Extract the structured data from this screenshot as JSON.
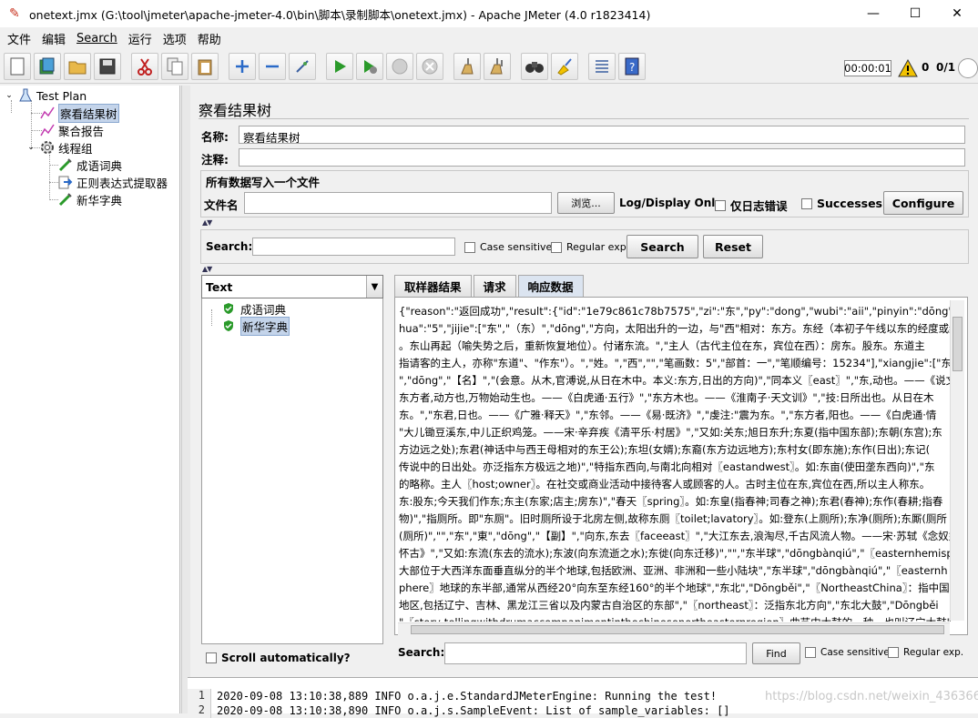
{
  "window": {
    "title": "onetext.jmx (G:\\tool\\jmeter\\apache-jmeter-4.0\\bin\\脚本\\录制脚本\\onetext.jmx) - Apache JMeter (4.0 r1823414)",
    "minimize": "—",
    "maximize": "☐",
    "close": "✕"
  },
  "menu": [
    "文件",
    "编辑",
    "Search",
    "运行",
    "选项",
    "帮助"
  ],
  "status": {
    "timer": "00:00:01",
    "errors": "0",
    "threads": "0/1"
  },
  "tree": {
    "test_plan": "Test Plan",
    "items": [
      "察看结果树",
      "聚合报告",
      "线程组",
      "成语词典",
      "正则表达式提取器",
      "新华字典"
    ]
  },
  "panel": {
    "title": "察看结果树",
    "name_label": "名称:",
    "name_value": "察看结果树",
    "comment_label": "注释:",
    "comment_value": "",
    "file_group_title": "所有数据写入一个文件",
    "filename_label": "文件名",
    "filename_value": "",
    "browse": "浏览...",
    "log_display": "Log/Display Only:",
    "errors_only": "仅日志错误",
    "successes": "Successes",
    "configure": "Configure"
  },
  "search": {
    "label": "Search:",
    "value": "",
    "case_sensitive": "Case sensitive",
    "regular_exp": "Regular exp.",
    "search_btn": "Search",
    "reset_btn": "Reset"
  },
  "results": {
    "renderer": "Text",
    "samples": [
      "成语词典",
      "新华字典"
    ],
    "scroll_auto": "Scroll automatically?"
  },
  "tabs": [
    "取样器结果",
    "请求",
    "响应数据"
  ],
  "response": {
    "lines": [
      "{\"reason\":\"返回成功\",\"result\":{\"id\":\"1e79c861c78b7575\",\"zi\":\"东\",\"py\":\"dong\",\"wubi\":\"aii\",\"pinyin\":\"dōng\",\"bushou\":\"",
      "hua\":\"5\",\"jijie\":[\"东\",\"（东）\",\"dōng\",\"方向，太阳出升的一边，与\"西\"相对：东方。东经（本初子午线以东的经度或经",
      "。东山再起（喻失势之后，重新恢复地位）。付诸东流。\",\"主人（古代主位在东，宾位在西）：房东。股东。东道主",
      "指请客的主人，亦称\"东道\"、\"作东\"）。\",\"姓。\",\"西\",\"\",\"笔画数：5\",\"部首：一\",\"笔顺编号：15234\"],\"xiangjie\":[\"东",
      "\",\"dōng\",\"【名】\",\"(会意。从木,官溥说,从日在木中。本义:东方,日出的方向)\",\"同本义〖east〗\",\"东,动也。——《说文",
      "东方者,动方也,万物始动生也。——《白虎通·五行》\",\"东方木也。——《淮南子·天文训》\",\"技:日所出也。从日在木",
      "东。\",\"东君,日也。——《广雅·释天》\",\"东邻。——《易·既济》\",\"虔注:\"震为东。\",\"东方者,阳也。——《白虎通·情",
      "\"大儿锄豆溪东,中儿正织鸡笼。——宋·辛弃疾《清平乐·村居》\",\"又如:关东;旭日东升;东夏(指中国东部);东朝(东宫);东",
      "方边远之处);东君(神话中与西王母相对的东王公);东坦(女婿);东裔(东方边远地方);东村女(即东施);东作(日出);东记(",
      "传说中的日出处。亦泛指东方极远之地)\",\"特指东西向,与南北向相对〖eastandwest〗。如:东亩(使田垄东西向)\",\"东",
      "的略称。主人〖host;owner〗。在社交或商业活动中接待客人或顾客的人。古时主位在东,宾位在西,所以主人称东。",
      "东:股东;今天我们作东;东主(东家;店主;房东)\",\"春天〖spring〗。如:东皇(指春神;司春之神);东君(春神);东作(春耕;指春",
      "物)\",\"指厕所。即\"东厕\"。旧时厕所设于北房左侧,故称东厕〖toilet;lavatory〗。如:登东(上厕所);东净(厕所);东厮(厕所",
      "(厕所)\",\"\",\"东\",\"東\",\"dōng\",\"【副】\",\"向东,东去〖faceeast〗\",\"大江东去,浪淘尽,千古风流人物。——宋·苏轼《念奴娇",
      "怀古》\",\"又如:东流(东去的流水);东波(向东流逝之水);东徙(向东迁移)\",\"\",\"东半球\",\"dōngbànqiú\",\"〖easternhemisph",
      "大部位于大西洋东面垂直纵分的半个地球,包括欧洲、亚洲、非洲和一些小陆块\",\"东半球\",\"dōngbànqiú\",\"〖easternh",
      "phere〗地球的东半部,通常从西经20°向东至东经160°的半个地球\",\"东北\",\"Dōngběi\",\"〖NortheastChina〗：指中国",
      "地区,包括辽宁、吉林、黑龙江三省以及内蒙古自治区的东部\",\"〖northeast〗：泛指东北方向\",\"东北大鼓\",\"Dōngběi",
      "\"〖story-tellingwithdrumaccompanimentinthechinesenortheasternregion〗曲艺中大鼓的一种。也叫辽宁大鼓\",\"东",
      "跑\",\"dōngbēn-xīpǎo\",\"〖bustleabout;drivefrompillartopillar;goinalldirectionsforruntoandfro〗朝东跑跑西跑。形容"
    ]
  },
  "find": {
    "label": "Search:",
    "value": "",
    "find_btn": "Find",
    "case_sensitive": "Case sensitive",
    "regular_exp": "Regular exp."
  },
  "log": [
    {
      "no": "1",
      "text": "2020-09-08 13:10:38,889 INFO o.a.j.e.StandardJMeterEngine: Running the test!"
    },
    {
      "no": "2",
      "text": "2020-09-08 13:10:38,890 INFO o.a.j.s.SampleEvent: List of sample_variables: []"
    }
  ],
  "watermark": "https://blog.csdn.net/weixin_43636675",
  "colors": {
    "accent": "#c4d4ea",
    "success": "#2a9a2a",
    "warning": "#f2c200"
  }
}
